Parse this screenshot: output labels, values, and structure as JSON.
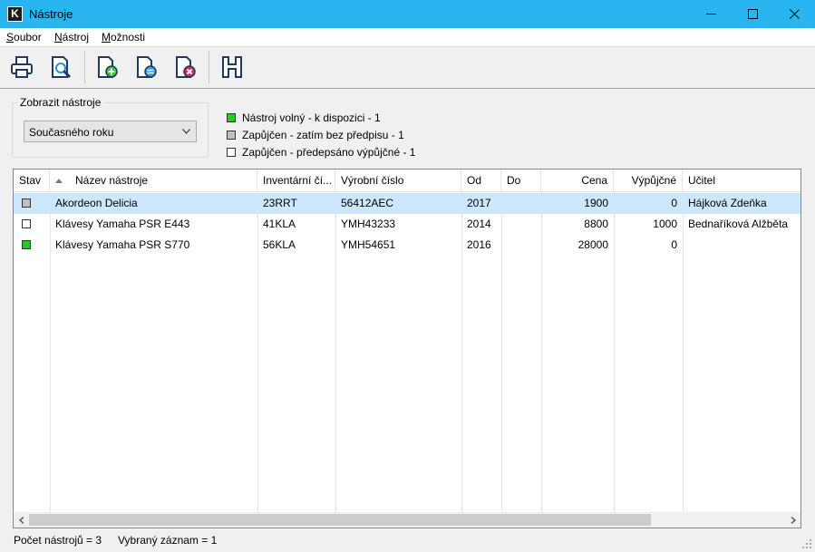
{
  "window": {
    "title": "Nástroje",
    "app_icon_letter": "K"
  },
  "menu": [
    {
      "label": "Soubor",
      "underline": "S",
      "rest": "oubor"
    },
    {
      "label": "Nástroj",
      "underline": "N",
      "rest": "ástroj"
    },
    {
      "label": "Možnosti",
      "underline": "M",
      "rest": "ožnosti"
    }
  ],
  "toolbar": {
    "buttons": [
      "print-icon",
      "print-preview-icon",
      "add-document-icon",
      "edit-document-icon",
      "delete-document-icon",
      "history-icon"
    ]
  },
  "filter": {
    "group_label": "Zobrazit nástroje",
    "selected": "Současného roku"
  },
  "legend": [
    {
      "color": "#22cc22",
      "text": "Nástroj volný - k dispozici - 1"
    },
    {
      "color": "#c0c0c0",
      "text": "Zapůjčen - zatím bez předpisu - 1"
    },
    {
      "color": "#ffffff",
      "text": "Zapůjčen - předepsáno výpůjčné - 1"
    }
  ],
  "table": {
    "columns": [
      "Stav",
      "Název nástroje",
      "Inventární čí...",
      "Výrobní číslo",
      "Od",
      "Do",
      "Cena",
      "Výpůjčné",
      "Učitel"
    ],
    "rows": [
      {
        "status_color": "#c0c0c0",
        "name": "Akordeon Delicia",
        "inventory": "23RRT",
        "serial": "56412AEC",
        "from": "2017",
        "to": "",
        "price": "1900",
        "rent": "0",
        "teacher": "Hájková Zdeňka",
        "selected": true
      },
      {
        "status_color": "#ffffff",
        "name": "Klávesy Yamaha PSR E443",
        "inventory": "41KLA",
        "serial": "YMH43233",
        "from": "2014",
        "to": "",
        "price": "8800",
        "rent": "1000",
        "teacher": "Bednaříková Alžběta",
        "selected": false
      },
      {
        "status_color": "#22cc22",
        "name": "Klávesy Yamaha PSR S770",
        "inventory": "56KLA",
        "serial": "YMH54651",
        "from": "2016",
        "to": "",
        "price": "28000",
        "rent": "0",
        "teacher": "",
        "selected": false
      }
    ]
  },
  "statusbar": {
    "count": "Počet nástrojů = 3",
    "selected": "Vybraný záznam = 1"
  },
  "colors": {
    "titlebar": "#29b5f0",
    "selection": "#cce8ff"
  }
}
